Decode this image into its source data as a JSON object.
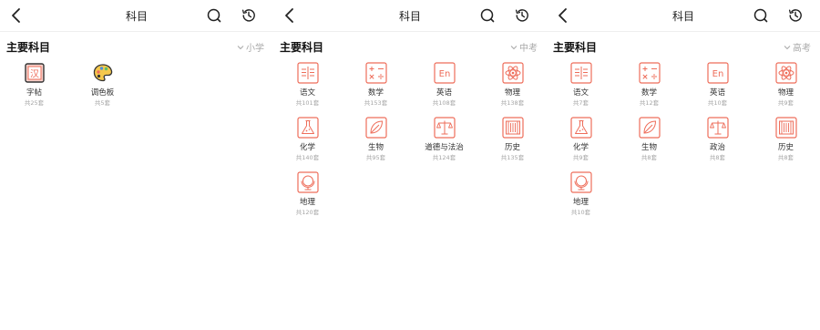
{
  "colors": {
    "accent": "#ee6d5a",
    "text": "#222222",
    "muted": "#a8a8a8",
    "yellow": "#f5c84c"
  },
  "screens": [
    {
      "title": "科目",
      "section_title": "主要科目",
      "level": "小学",
      "subjects": [
        {
          "name": "字帖",
          "count": "共25套",
          "icon": "zitie-icon"
        },
        {
          "name": "调色板",
          "count": "共5套",
          "icon": "palette-icon"
        }
      ]
    },
    {
      "title": "科目",
      "section_title": "主要科目",
      "level": "中考",
      "subjects": [
        {
          "name": "语文",
          "count": "共101套",
          "icon": "chinese-icon"
        },
        {
          "name": "数学",
          "count": "共153套",
          "icon": "math-icon"
        },
        {
          "name": "英语",
          "count": "共108套",
          "icon": "english-icon"
        },
        {
          "name": "物理",
          "count": "共138套",
          "icon": "physics-icon"
        },
        {
          "name": "化学",
          "count": "共140套",
          "icon": "chemistry-icon"
        },
        {
          "name": "生物",
          "count": "共95套",
          "icon": "biology-icon"
        },
        {
          "name": "道德与法治",
          "count": "共124套",
          "icon": "politics-icon"
        },
        {
          "name": "历史",
          "count": "共135套",
          "icon": "history-icon"
        },
        {
          "name": "地理",
          "count": "共120套",
          "icon": "geography-icon"
        }
      ]
    },
    {
      "title": "科目",
      "section_title": "主要科目",
      "level": "高考",
      "subjects": [
        {
          "name": "语文",
          "count": "共7套",
          "icon": "chinese-icon"
        },
        {
          "name": "数学",
          "count": "共12套",
          "icon": "math-icon"
        },
        {
          "name": "英语",
          "count": "共10套",
          "icon": "english-icon"
        },
        {
          "name": "物理",
          "count": "共9套",
          "icon": "physics-icon"
        },
        {
          "name": "化学",
          "count": "共9套",
          "icon": "chemistry-icon"
        },
        {
          "name": "生物",
          "count": "共8套",
          "icon": "biology-icon"
        },
        {
          "name": "政治",
          "count": "共8套",
          "icon": "politics-icon"
        },
        {
          "name": "历史",
          "count": "共8套",
          "icon": "history-icon"
        },
        {
          "name": "地理",
          "count": "共10套",
          "icon": "geography-icon"
        }
      ]
    }
  ]
}
